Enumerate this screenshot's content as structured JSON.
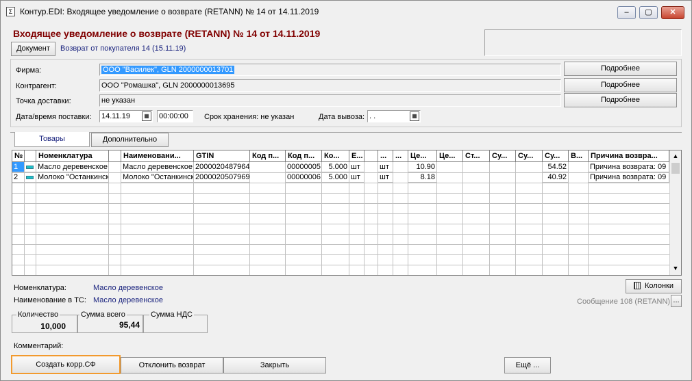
{
  "window": {
    "title": "Контур.EDI: Входящее уведомление о возврате (RETANN) № 14 от 14.11.2019",
    "minimize": "–",
    "maximize": "▢",
    "close": "✕",
    "app_icon": "Σ"
  },
  "header": {
    "doc_title": "Входящее уведомление о возврате (RETANN) № 14 от 14.11.2019",
    "document_button": "Документ",
    "document_link": "Возврат от покупателя 14 (15.11.19)"
  },
  "form": {
    "firma_label": "Фирма:",
    "firma_value": "ООО \"Василек\", GLN 2000000013701",
    "kontragent_label": "Контрагент:",
    "kontragent_value": "ООО \"Ромашка\", GLN 2000000013695",
    "tochka_label": "Точка доставки:",
    "tochka_value": "не указан",
    "details_button": "Подробнее",
    "date_label": "Дата/время поставки:",
    "date_value": "14.11.19",
    "time_value": "00:00:00",
    "storage_label": "Срок хранения: не указан",
    "export_label": "Дата вывоза:",
    "export_value": " .  ."
  },
  "tabs": {
    "goods": "Товары",
    "additional": "Дополнительно"
  },
  "table": {
    "headers": [
      "№",
      "",
      "Номенклатура",
      "",
      "Наименовани...",
      "GTIN",
      "Код п...",
      "Код п...",
      "Ко...",
      "Е...",
      "",
      "...",
      "...",
      "Це...",
      "Це...",
      "Ст...",
      "Су...",
      "Су...",
      "Су...",
      "В...",
      "Причина возвра..."
    ],
    "rows": [
      [
        "1",
        "",
        "Масло деревенское",
        "",
        "Масло деревенское",
        "2000020487964",
        "",
        "00000005",
        "5.000",
        "шт",
        "",
        "шт",
        "",
        "10.90",
        "",
        "",
        "",
        "",
        "54.52",
        "",
        "Причина возврата: 09"
      ],
      [
        "2",
        "",
        "Молоко \"Останкинское\"",
        "",
        "Молоко \"Останкинское\"",
        "2000020507969",
        "",
        "00000006",
        "5.000",
        "шт",
        "",
        "шт",
        "",
        "8.18",
        "",
        "",
        "",
        "",
        "40.92",
        "",
        "Причина возврата: 09"
      ]
    ]
  },
  "details": {
    "nomenklatura_label": "Номенклатура:",
    "nomenklatura_value": "Масло деревенское",
    "naim_label": "Наименование в ТС:",
    "naim_value": "Масло деревенское",
    "columns_button": "Колонки",
    "message_text": "Сообщение 108 (RETANN)",
    "message_button": "..."
  },
  "summary": {
    "qty_label": "Количество",
    "qty_value": "10,000",
    "sum_label": "Сумма всего",
    "sum_value": "95,44",
    "nds_label": "Сумма НДС",
    "nds_value": ""
  },
  "footer": {
    "comment_label": "Комментарий:",
    "create_button": "Создать корр.СФ",
    "reject_button": "Отклонить возврат",
    "close_button": "Закрыть",
    "more_button": "Ещё ..."
  },
  "colors": {
    "title_red": "#800000",
    "link_blue": "#1a237e",
    "highlight": "#3399ff",
    "focus_orange": "#f29a2e"
  }
}
